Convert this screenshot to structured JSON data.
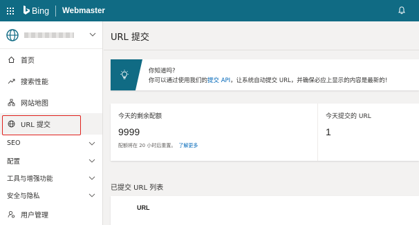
{
  "header": {
    "bing_text": "Bing",
    "product": "Webmaster"
  },
  "sidebar": {
    "items": [
      {
        "label": "首页",
        "icon": "home-icon"
      },
      {
        "label": "搜索性能",
        "icon": "trend-icon"
      },
      {
        "label": "网站地图",
        "icon": "sitemap-icon"
      },
      {
        "label": "URL 提交",
        "icon": "globe-icon",
        "active": true
      }
    ],
    "sections": [
      {
        "label": "SEO"
      },
      {
        "label": "配置"
      },
      {
        "label": "工具与增强功能"
      },
      {
        "label": "安全与隐私"
      }
    ],
    "user_item": {
      "label": "用户管理",
      "icon": "user-settings-icon"
    }
  },
  "main": {
    "title": "URL 提交",
    "tip": {
      "title": "你知道吗?",
      "prefix": "你可以通过使用我们的",
      "link": "提交 API",
      "suffix": "，让系统自动提交 URL，并确保必应上显示的内容是最新的!"
    },
    "quota": {
      "label": "今天的剩余配额",
      "value": "9999",
      "note": "配额将在 20 小时后重置。",
      "note_link": "了解更多"
    },
    "submitted": {
      "label": "今天提交的 URL",
      "value": "1"
    },
    "list": {
      "title": "已提交 URL 列表",
      "column": "URL"
    }
  },
  "colors": {
    "topbar": "#106b84",
    "link": "#0067b8",
    "highlight_outline": "#e0201c"
  }
}
